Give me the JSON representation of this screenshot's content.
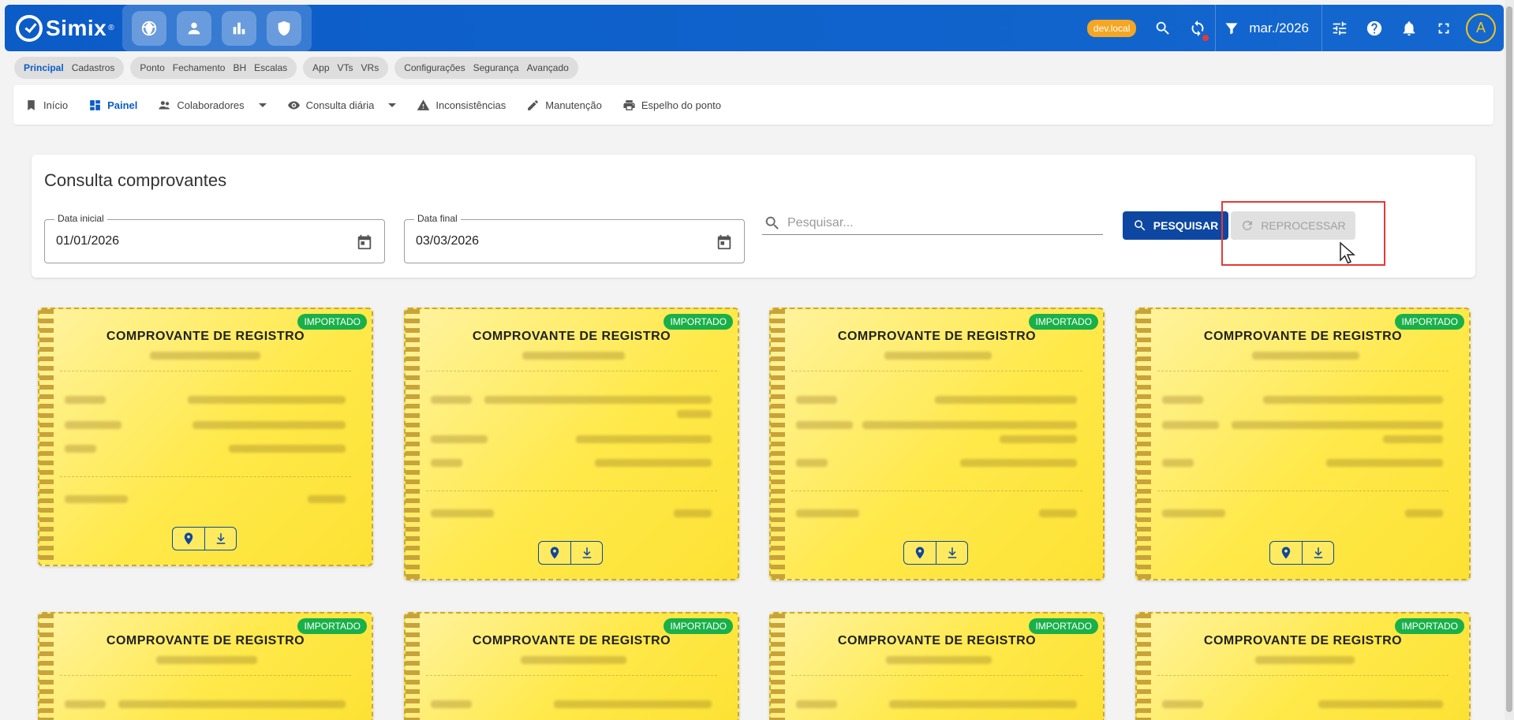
{
  "app": {
    "name": "Simix",
    "env_badge": "dev.local",
    "period": "mar./2026",
    "avatar_initial": "A"
  },
  "modules": [
    "globe-icon",
    "person-icon",
    "bar-chart-icon",
    "shield-icon"
  ],
  "chips": [
    {
      "items": [
        "Principal",
        "Cadastros"
      ],
      "active": "Principal"
    },
    {
      "items": [
        "Ponto",
        "Fechamento",
        "BH",
        "Escalas"
      ]
    },
    {
      "items": [
        "App",
        "VTs",
        "VRs"
      ]
    },
    {
      "items": [
        "Configurações",
        "Segurança",
        "Avançado"
      ]
    }
  ],
  "nav": {
    "inicio": "Início",
    "painel": "Painel",
    "colaboradores": "Colaboradores",
    "consulta": "Consulta diária",
    "inconsistencias": "Inconsistências",
    "manutencao": "Manutenção",
    "espelho": "Espelho do ponto"
  },
  "filter": {
    "title": "Consulta comprovantes",
    "start_label": "Data inicial",
    "start_value": "01/01/2026",
    "end_label": "Data final",
    "end_value": "03/03/2026",
    "search_placeholder": "Pesquisar...",
    "search_button": "PESQUISAR",
    "reprocess_button": "REPROCESSAR"
  },
  "receipt": {
    "title": "COMPROVANTE DE REGISTRO",
    "status": "IMPORTADO"
  },
  "colors": {
    "primary": "#0d47a1",
    "appbar": "#0b5cc7",
    "status_green": "#19b04a",
    "card_yellow": "#ffe94a",
    "highlight": "#e53935"
  }
}
